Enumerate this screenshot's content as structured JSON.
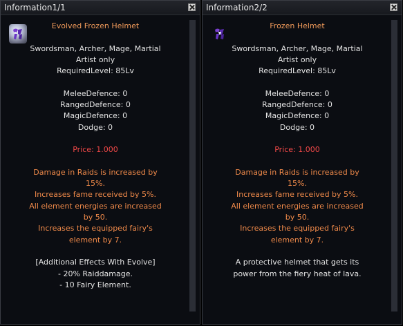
{
  "colors": {
    "panel_bg": "#0b0d12",
    "name": "#f09a5a",
    "price": "#f04848",
    "effect": "#f08a4a",
    "text": "#e4e4e4"
  },
  "panels": [
    {
      "title": "Information1/1",
      "close_icon": "close-icon",
      "item_icon": "frozen-helmet-icon",
      "name": "Evolved Frozen Helmet",
      "classes": "Swordsman, Archer, Mage, Martial",
      "classes2": "Artist only",
      "required_level": "RequiredLevel: 85Lv",
      "melee": "MeleeDefence: 0",
      "ranged": "RangedDefence: 0",
      "magic": "MagicDefence: 0",
      "dodge": "Dodge: 0",
      "price": "Price: 1.000",
      "effects": [
        "Damage in Raids is increased by",
        "15%.",
        "Increases fame received by 5%.",
        "All element energies are increased",
        "by 50.",
        "Increases the equipped fairy's",
        "element by 7."
      ],
      "extra": [
        "[Additional Effects With Evolve]",
        "- 20% Raiddamage.",
        "- 10 Fairy Element."
      ]
    },
    {
      "title": "Information2/2",
      "close_icon": "close-icon",
      "item_icon": "frozen-helmet-icon",
      "name": "Frozen Helmet",
      "classes": "Swordsman, Archer, Mage, Martial",
      "classes2": "Artist only",
      "required_level": "RequiredLevel: 85Lv",
      "melee": "MeleeDefence: 0",
      "ranged": "RangedDefence: 0",
      "magic": "MagicDefence: 0",
      "dodge": "Dodge: 0",
      "price": "Price: 1.000",
      "effects": [
        "Damage in Raids is increased by",
        "15%.",
        "Increases fame received by 5%.",
        "All element energies are increased",
        "by 50.",
        "Increases the equipped fairy's",
        "element by 7."
      ],
      "extra": [
        "A protective helmet that gets its",
        "power from the fiery heat of lava."
      ]
    }
  ]
}
